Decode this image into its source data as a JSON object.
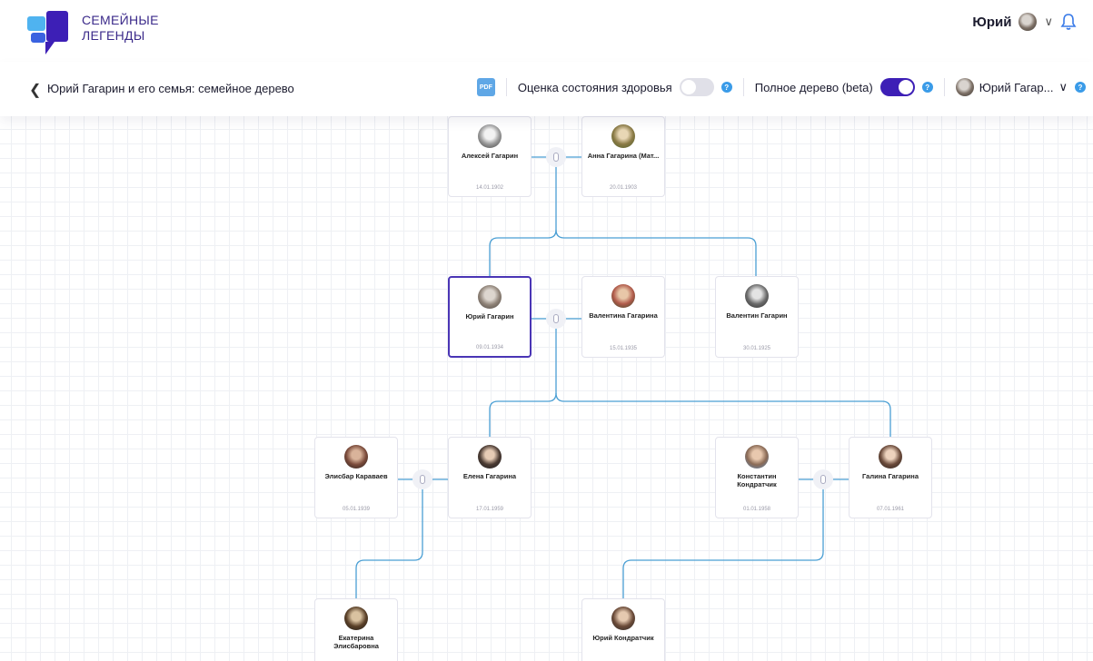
{
  "brand": {
    "line1": "СЕМЕЙНЫЕ",
    "line2": "ЛЕГЕНДЫ"
  },
  "user": {
    "name": "Юрий"
  },
  "toolbar": {
    "title": "Юрий Гагарин и его семья: семейное дерево",
    "pdf_label": "PDF",
    "health_label": "Оценка состояния здоровья",
    "full_tree_label": "Полное дерево (beta)",
    "person_label": "Юрий Гагар...",
    "help": "?"
  },
  "people": {
    "aleksei": {
      "name": "Алексей Гагарин",
      "date": "14.01.1902"
    },
    "anna": {
      "name": "Анна Гагарина (Мат...",
      "date": "20.01.1903"
    },
    "yuri": {
      "name": "Юрий Гагарин",
      "date": "09.01.1934"
    },
    "valentina": {
      "name": "Валентина Гагарина",
      "date": "15.01.1935"
    },
    "valentin": {
      "name": "Валентин Гагарин",
      "date": "30.01.1925"
    },
    "elisbar": {
      "name": "Элисбар Караваев",
      "date": "05.01.1939"
    },
    "elena": {
      "name": "Елена Гагарина",
      "date": "17.01.1959"
    },
    "konstantin": {
      "name": "Константин Кондратчик",
      "date": "01.01.1958"
    },
    "galina": {
      "name": "Галина Гагарина",
      "date": "07.01.1961"
    },
    "ekaterina": {
      "name": "Екатерина Элисбаровна"
    },
    "yuri_k": {
      "name": "Юрий Кондратчик"
    }
  },
  "colors": {
    "accent": "#3d1fb6",
    "line": "#4a9fd4",
    "help": "#3a9be8"
  }
}
